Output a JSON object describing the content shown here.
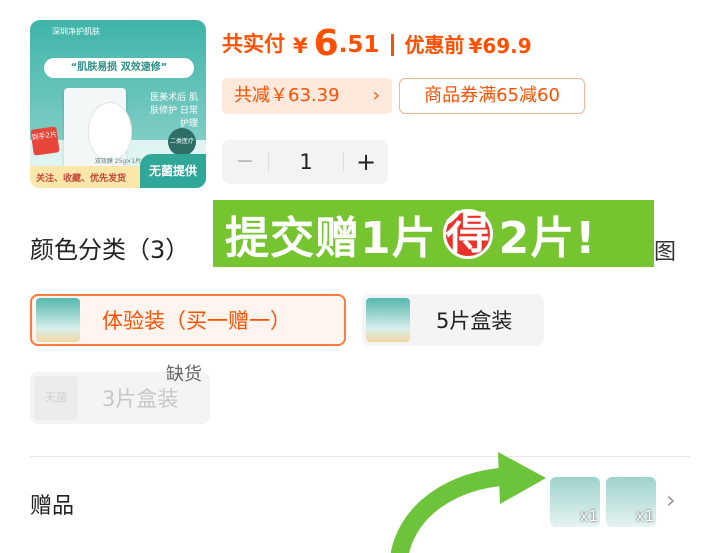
{
  "product": {
    "thumbnail": {
      "brand": "深圳净护肌肤",
      "slogan": "“肌肤易损 双效速修”",
      "side_text": "医美术后 肌肤修护 日常护理",
      "seal_text": "二类医疗器械",
      "badge_text": "到手2片",
      "spec_text": "双效膜 25g×1片",
      "bottom_text": "关注、收藏、优先发货",
      "sterile_label": "无菌提供"
    }
  },
  "price": {
    "label": "共实付",
    "currency": "¥",
    "integer": "6",
    "decimal": ".51",
    "original_label": "优惠前",
    "original_price": "¥69.9"
  },
  "discounts": {
    "total_saved": "共减￥63.39",
    "chevron": "›",
    "coupon": "商品券满65减60"
  },
  "quantity": {
    "minus": "−",
    "value": "1",
    "plus": "+"
  },
  "variants": {
    "title": "颜色分类（3）",
    "big_view_label": "大图",
    "options": [
      {
        "label": "体验装（买一赠一）",
        "state": "selected"
      },
      {
        "label": "5片盒装",
        "state": "available"
      },
      {
        "label": "3片盒装",
        "state": "sold_out",
        "thumb_text": "无菌"
      }
    ],
    "sold_out_tag": "缺货"
  },
  "promo_banner": {
    "text_before": "提交赠1片",
    "circle_char": "得",
    "text_after": "2片!",
    "background_color": "#75c430",
    "circle_color": "#e8322a"
  },
  "gifts": {
    "label": "赠品",
    "items": [
      {
        "qty": "x1"
      },
      {
        "qty": "x1"
      }
    ],
    "chevron": "›"
  },
  "colors": {
    "accent": "#ff5000",
    "annotation_green": "#6cc43a"
  }
}
